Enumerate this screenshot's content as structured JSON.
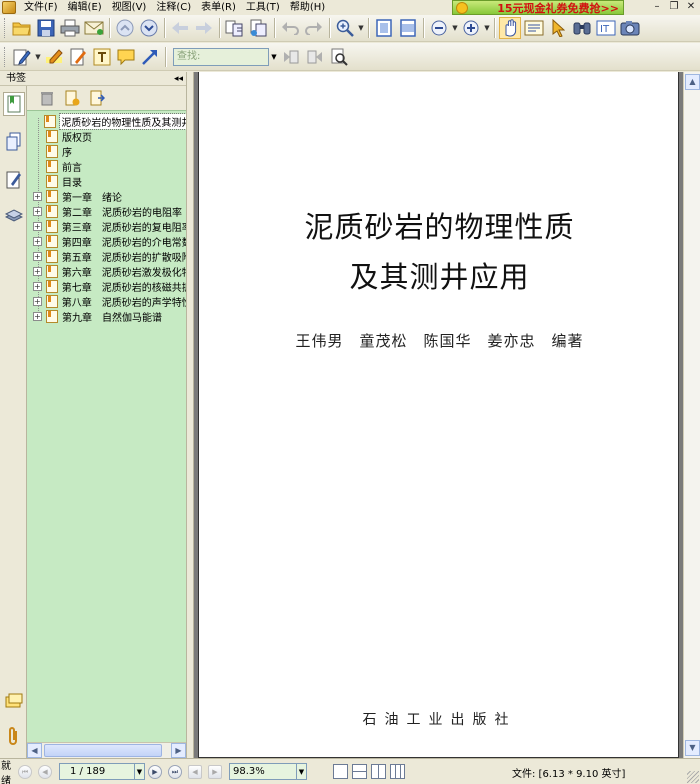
{
  "menu": {
    "items": [
      "文件(F)",
      "编辑(E)",
      "视图(V)",
      "注释(C)",
      "表单(R)",
      "工具(T)",
      "帮助(H)"
    ]
  },
  "ad_banner": {
    "text": "15元现金礼券免费抢>>"
  },
  "toolbar2": {
    "search_placeholder": "查找:"
  },
  "left_pane": {
    "title": "书签",
    "bookmarks": [
      {
        "label": "泥质砂岩的物理性质及其测井应用",
        "expandable": false,
        "selected": true
      },
      {
        "label": "版权页",
        "expandable": false
      },
      {
        "label": "序",
        "expandable": false
      },
      {
        "label": "前言",
        "expandable": false
      },
      {
        "label": "目录",
        "expandable": false
      },
      {
        "label": "第一章　绪论",
        "expandable": true
      },
      {
        "label": "第二章　泥质砂岩的电阻率",
        "expandable": true
      },
      {
        "label": "第三章　泥质砂岩的复电阻率",
        "expandable": true
      },
      {
        "label": "第四章　泥质砂岩的介电常数",
        "expandable": true
      },
      {
        "label": "第五章　泥质砂岩的扩散吸附电位",
        "expandable": true
      },
      {
        "label": "第六章　泥质砂岩激发极化特性",
        "expandable": true
      },
      {
        "label": "第七章　泥质砂岩的核磁共振",
        "expandable": true
      },
      {
        "label": "第八章　泥质砂岩的声学特性",
        "expandable": true
      },
      {
        "label": "第九章　自然伽马能谱",
        "expandable": true
      }
    ]
  },
  "document": {
    "title_line1": "泥质砂岩的物理性质",
    "title_line2": "及其测井应用",
    "authors": "王伟男　童茂松　陈国华　姜亦忠　编著",
    "publisher": "石油工业出版社"
  },
  "statusbar": {
    "ready": "就绪",
    "page_display": "1 / 189",
    "zoom": "98.3%",
    "file_info": "文件: [6.13 * 9.10 英寸]"
  },
  "colors": {
    "bookmark_bg": "#c6eac3",
    "toolbar_bg": "#ece9d8",
    "ad_text": "#d21010"
  }
}
